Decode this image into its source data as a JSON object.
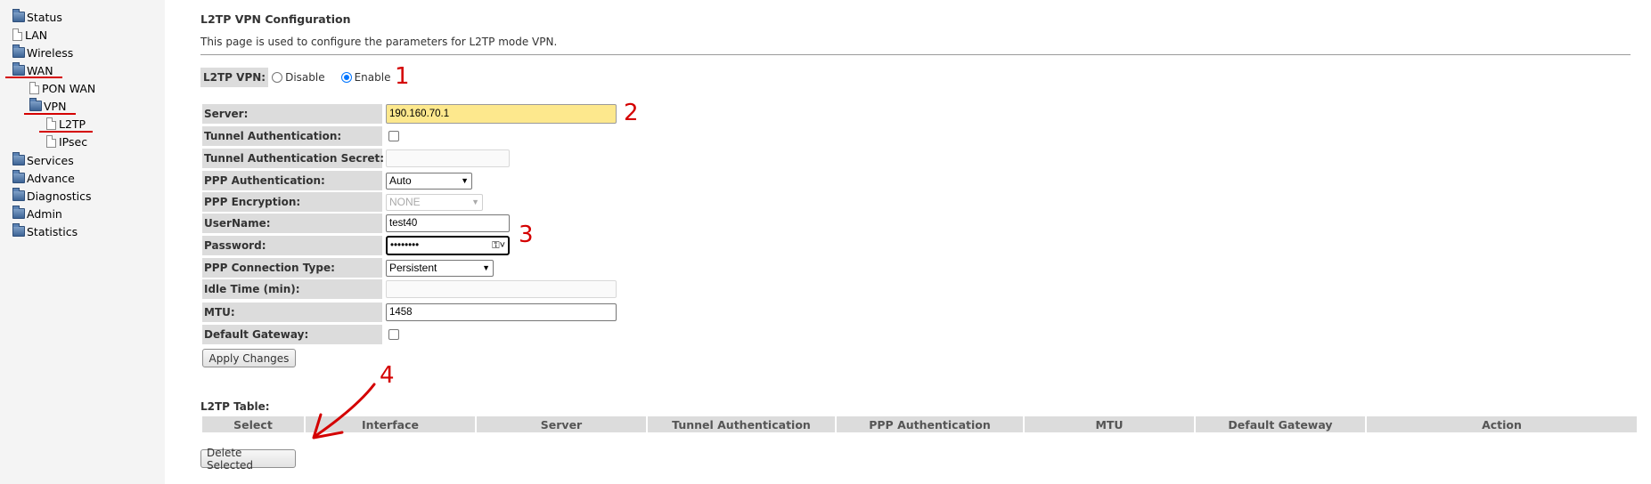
{
  "sidebar": {
    "items": [
      {
        "label": "Status",
        "icon": "folder-icon"
      },
      {
        "label": "LAN",
        "icon": "page-icon"
      },
      {
        "label": "Wireless",
        "icon": "folder-icon"
      },
      {
        "label": "WAN",
        "icon": "folder-icon"
      },
      {
        "label": "PON WAN",
        "icon": "page-icon"
      },
      {
        "label": "VPN",
        "icon": "folder-icon"
      },
      {
        "label": "L2TP",
        "icon": "page-icon"
      },
      {
        "label": "IPsec",
        "icon": "page-icon"
      },
      {
        "label": "Services",
        "icon": "folder-icon"
      },
      {
        "label": "Advance",
        "icon": "folder-icon"
      },
      {
        "label": "Diagnostics",
        "icon": "folder-icon"
      },
      {
        "label": "Admin",
        "icon": "folder-icon"
      },
      {
        "label": "Statistics",
        "icon": "folder-icon"
      }
    ]
  },
  "page": {
    "title": "L2TP VPN Configuration",
    "description": "This page is used to configure the parameters for L2TP mode VPN."
  },
  "vpn_toggle": {
    "label": "L2TP VPN:",
    "disable_label": "Disable",
    "enable_label": "Enable",
    "selected": "Enable"
  },
  "form": {
    "server": {
      "label": "Server:",
      "value": "190.160.70.1"
    },
    "tunnel_auth": {
      "label": "Tunnel Authentication:",
      "checked": false
    },
    "tunnel_secret": {
      "label": "Tunnel Authentication Secret:",
      "value": ""
    },
    "ppp_auth": {
      "label": "PPP Authentication:",
      "value": "Auto"
    },
    "ppp_encryption": {
      "label": "PPP Encryption:",
      "value": "NONE"
    },
    "username": {
      "label": "UserName:",
      "value": "test40"
    },
    "password": {
      "label": "Password:",
      "value": "••••••••"
    },
    "conn_type": {
      "label": "PPP Connection Type:",
      "value": "Persistent"
    },
    "idle_time": {
      "label": "Idle Time (min):",
      "value": ""
    },
    "mtu": {
      "label": "MTU:",
      "value": "1458"
    },
    "default_gw": {
      "label": "Default Gateway:",
      "checked": false
    }
  },
  "buttons": {
    "apply": "Apply Changes",
    "delete_selected": "Delete Selected"
  },
  "table": {
    "title": "L2TP Table:",
    "columns": [
      "Select",
      "Interface",
      "Server",
      "Tunnel Authentication",
      "PPP Authentication",
      "MTU",
      "Default Gateway",
      "Action"
    ]
  },
  "annotations": [
    "1",
    "2",
    "3",
    "4"
  ],
  "colors": {
    "annotation": "#d40000",
    "label_bg": "#dcdcdc",
    "server_highlight": "#fde88d",
    "radio_accent": "#0075ff"
  }
}
